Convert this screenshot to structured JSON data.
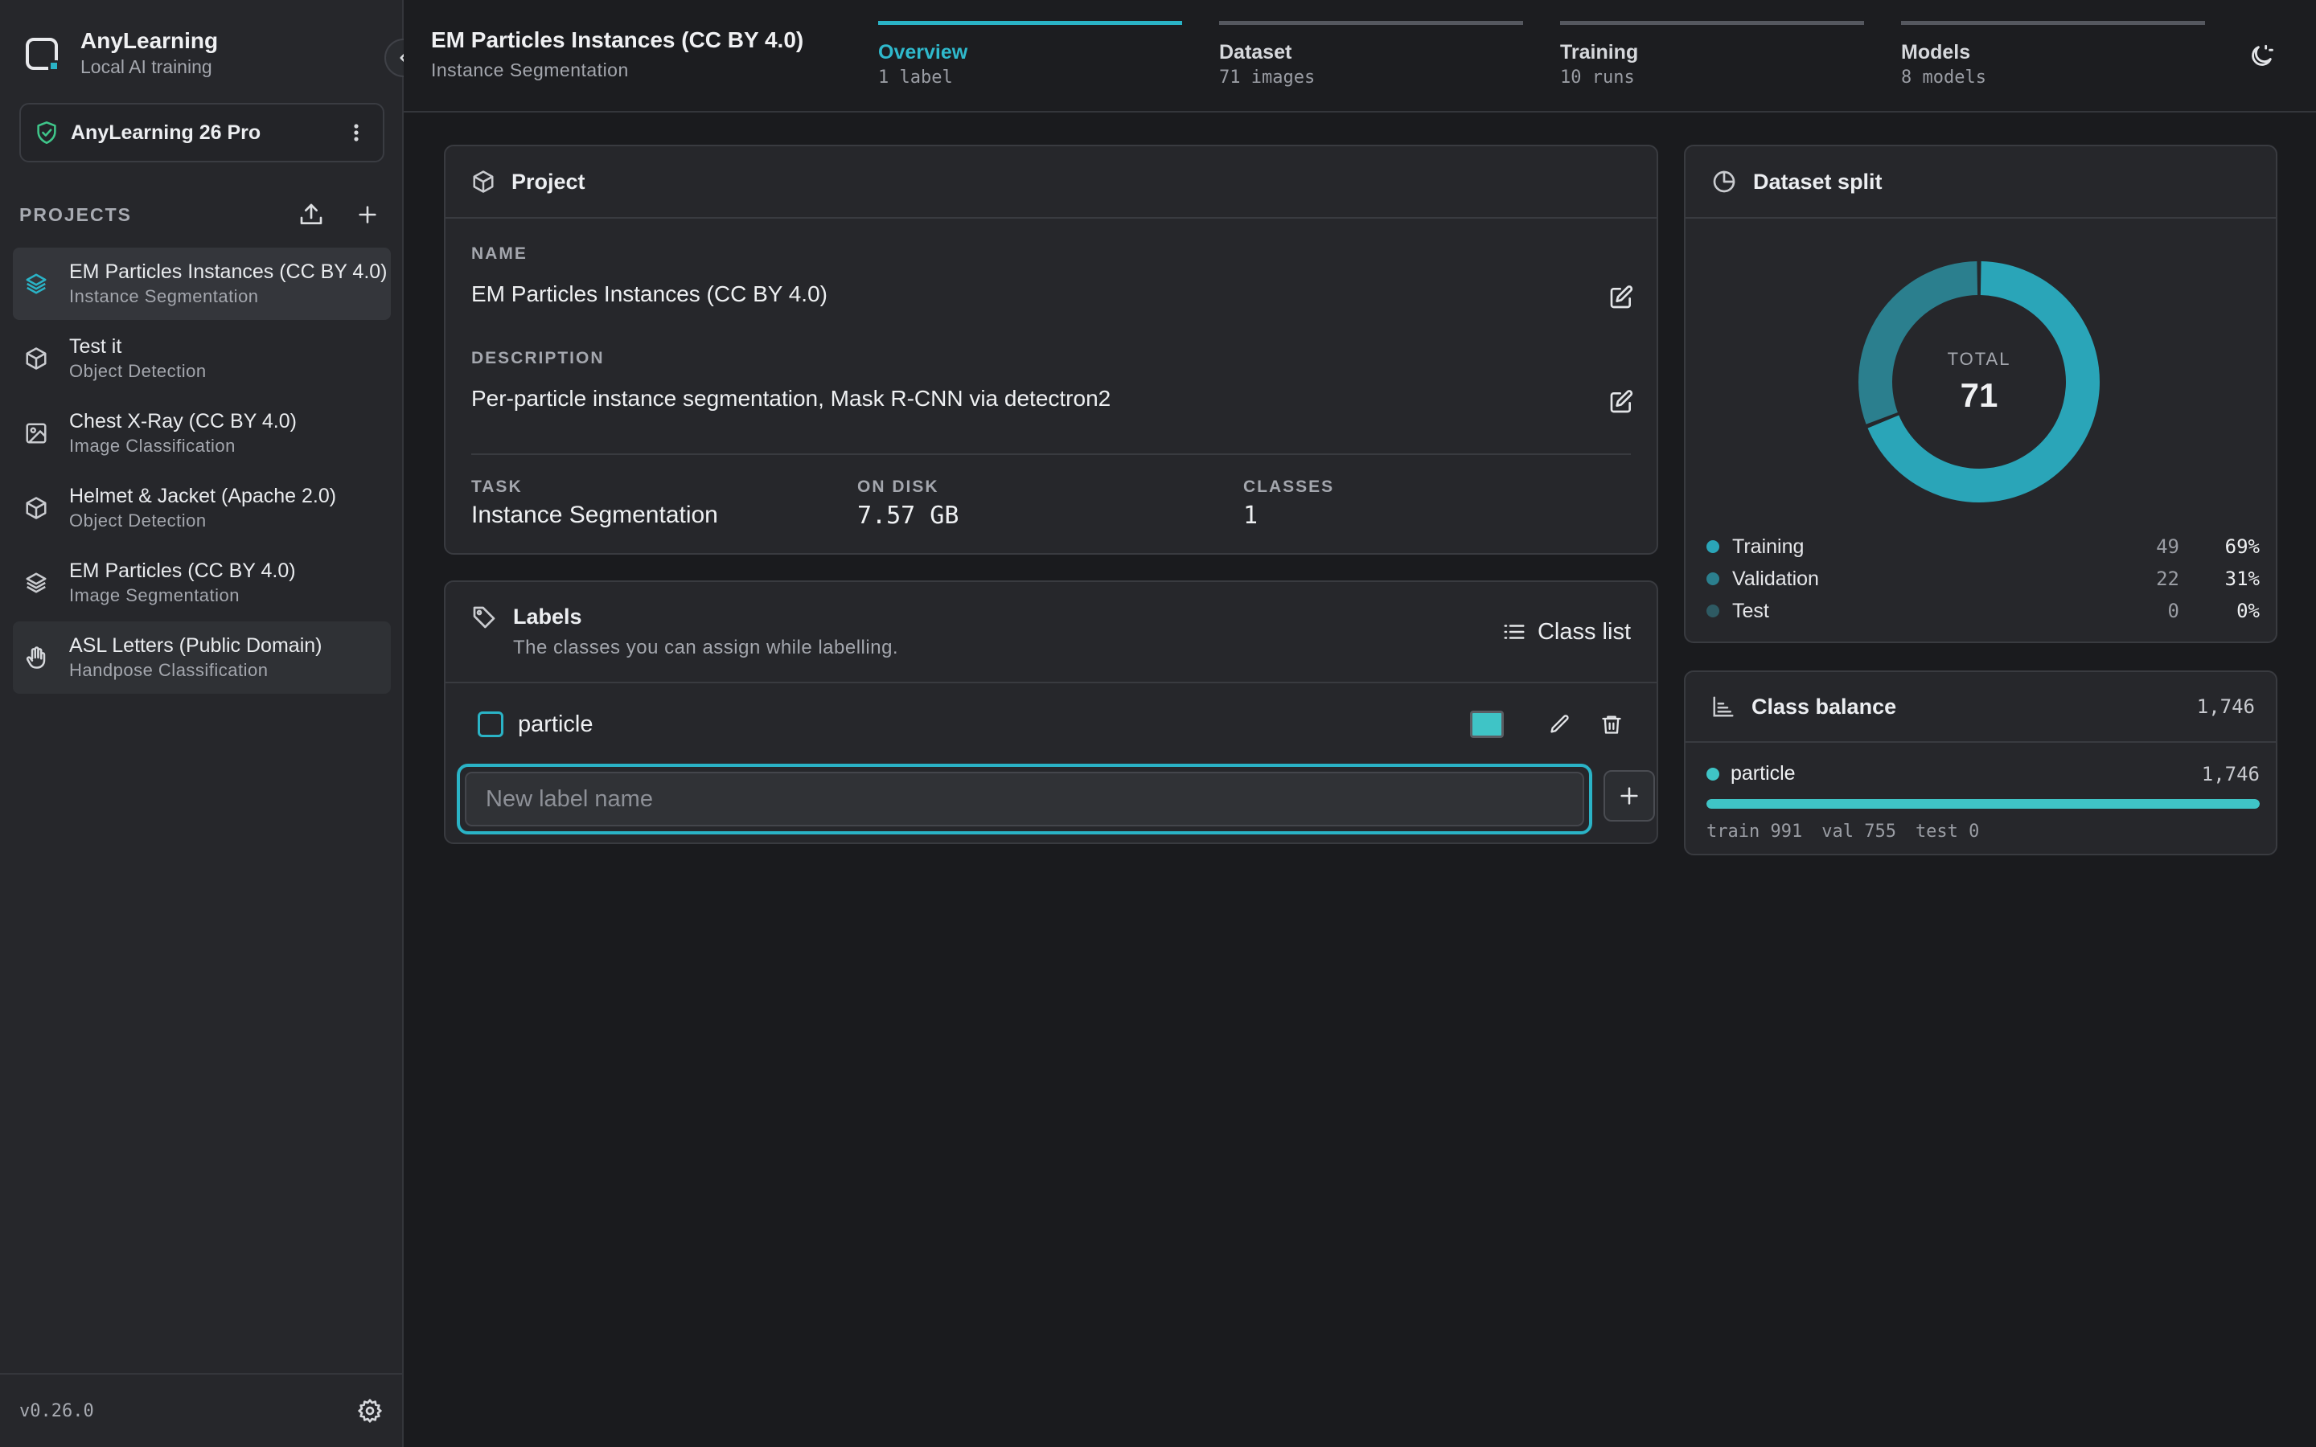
{
  "app": {
    "name": "AnyLearning",
    "subtitle": "Local AI training",
    "version": "v0.26.0"
  },
  "license": {
    "label": "AnyLearning 26 Pro"
  },
  "sidebar": {
    "projects_heading": "PROJECTS",
    "projects": [
      {
        "title": "EM Particles Instances (CC BY 4.0)",
        "subtitle": "Instance Segmentation",
        "icon": "layers-icon"
      },
      {
        "title": "Test it",
        "subtitle": "Object Detection",
        "icon": "cube-icon"
      },
      {
        "title": "Chest X-Ray (CC BY 4.0)",
        "subtitle": "Image Classification",
        "icon": "image-icon"
      },
      {
        "title": "Helmet & Jacket (Apache 2.0)",
        "subtitle": "Object Detection",
        "icon": "cube-icon"
      },
      {
        "title": "EM Particles (CC BY 4.0)",
        "subtitle": "Image Segmentation",
        "icon": "layers-icon"
      },
      {
        "title": "ASL Letters (Public Domain)",
        "subtitle": "Handpose Classification",
        "icon": "hand-icon"
      }
    ]
  },
  "header": {
    "title": "EM Particles Instances (CC BY 4.0)",
    "subtitle": "Instance Segmentation",
    "tabs": [
      {
        "label": "Overview",
        "sub": "1 label"
      },
      {
        "label": "Dataset",
        "sub": "71 images"
      },
      {
        "label": "Training",
        "sub": "10 runs"
      },
      {
        "label": "Models",
        "sub": "8 models"
      }
    ]
  },
  "project_card": {
    "title": "Project",
    "name_label": "NAME",
    "name_value": "EM Particles Instances (CC BY 4.0)",
    "description_label": "DESCRIPTION",
    "description_value": "Per-particle instance segmentation, Mask R-CNN via detectron2",
    "task_label": "TASK",
    "task_value": "Instance Segmentation",
    "disk_label": "ON DISK",
    "disk_value": "7.57 GB",
    "classes_label": "CLASSES",
    "classes_value": "1"
  },
  "labels_card": {
    "title": "Labels",
    "subtitle": "The classes you can assign while labelling.",
    "class_list_label": "Class list",
    "labels": [
      {
        "name": "particle",
        "color": "#3fc4c6"
      }
    ],
    "new_label_placeholder": "New label name"
  },
  "dataset_split": {
    "title": "Dataset split",
    "total_label": "TOTAL",
    "total_value": "71",
    "rows": [
      {
        "name": "Training",
        "count": "49",
        "pct": "69%",
        "color": "#2aa5b8",
        "fraction": 0.69
      },
      {
        "name": "Validation",
        "count": "22",
        "pct": "31%",
        "color": "#2b7f8e",
        "fraction": 0.31
      },
      {
        "name": "Test",
        "count": "0",
        "pct": "0%",
        "color": "#2e5a63",
        "fraction": 0.0
      }
    ]
  },
  "class_balance": {
    "title": "Class balance",
    "total": "1,746",
    "rows": [
      {
        "name": "particle",
        "count": "1,746",
        "fraction": 1.0,
        "splits": [
          "train 991",
          "val 755",
          "test 0"
        ]
      }
    ]
  },
  "colors": {
    "accent": "#2ab3c6",
    "background": "#1a1b1e",
    "panel": "#26272b"
  }
}
